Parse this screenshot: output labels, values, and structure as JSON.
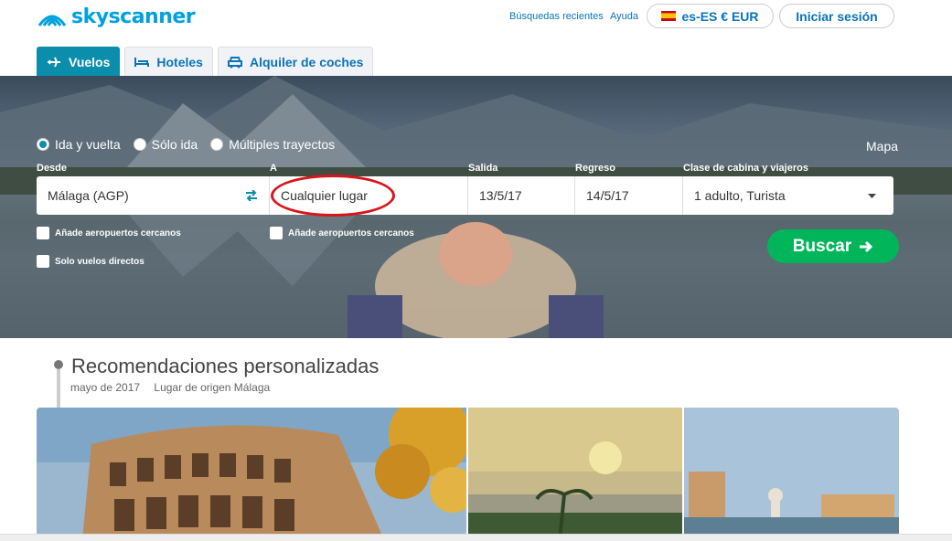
{
  "brand": {
    "name": "skyscanner",
    "color": "#00a1de"
  },
  "header": {
    "recent_searches": "Búsquedas recientes",
    "help": "Ayuda",
    "locale": "es-ES € EUR",
    "login": "Iniciar sesión"
  },
  "tabs": [
    {
      "label": "Vuelos",
      "icon": "plane-icon",
      "active": true
    },
    {
      "label": "Hoteles",
      "icon": "bed-icon",
      "active": false
    },
    {
      "label": "Alquiler de coches",
      "icon": "car-icon",
      "active": false
    }
  ],
  "search": {
    "trip_types": [
      {
        "label": "Ida y vuelta",
        "checked": true
      },
      {
        "label": "Sólo ida",
        "checked": false
      },
      {
        "label": "Múltiples trayectos",
        "checked": false
      }
    ],
    "map_link": "Mapa",
    "from_label": "Desde",
    "from_value": "Málaga (AGP)",
    "to_label": "A",
    "to_value": "Cualquier lugar",
    "depart_label": "Salida",
    "depart_value": "13/5/17",
    "return_label": "Regreso",
    "return_value": "14/5/17",
    "cabin_label": "Clase de cabina y viajeros",
    "cabin_value": "1 adulto, Turista",
    "nearby_from": "Añade aeropuertos cercanos",
    "nearby_to": "Añade aeropuertos cercanos",
    "direct_only": "Solo vuelos directos",
    "submit": "Buscar"
  },
  "recommendations": {
    "title": "Recomendaciones personalizadas",
    "date": "mayo de 2017",
    "origin": "Lugar de origen Málaga"
  },
  "colors": {
    "accent": "#0b8eab",
    "submit": "#00b55a",
    "highlight": "#d9141b"
  }
}
